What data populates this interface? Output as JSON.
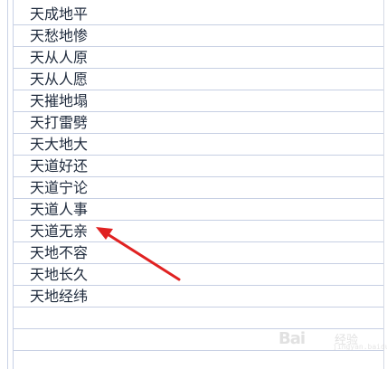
{
  "cells": [
    "天成地平",
    "天愁地惨",
    "天从人原",
    "天从人愿",
    "天摧地塌",
    "天打雷劈",
    "天大地大",
    "天道好还",
    "天道宁论",
    "天道人事",
    "天道无亲",
    "天地不容",
    "天地长久",
    "天地经纬"
  ],
  "empty_rows": 3,
  "highlighted_cell_index": 10,
  "annotation": {
    "arrow_color": "#e02222",
    "arrow_target": "天道无亲"
  },
  "watermark": {
    "logo": "Bai",
    "sub": "经验",
    "url": "jingyan.baidu.com"
  },
  "colors": {
    "grid_line": "#c6cfe3",
    "text": "#1e2a3c",
    "arrow": "#e02222"
  }
}
